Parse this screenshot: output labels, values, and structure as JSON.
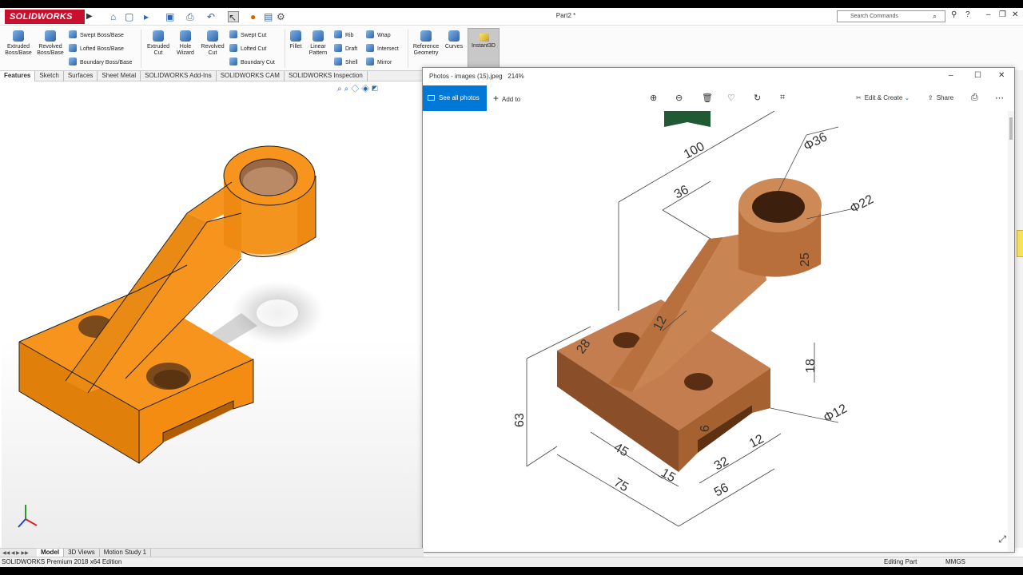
{
  "app": {
    "logo_text": "SOLIDWORKS",
    "document_title": "Part2 *",
    "search_placeholder": "Search Commands"
  },
  "ribbon": {
    "extruded_boss": "Extruded Boss/Base",
    "revolved_boss": "Revolved Boss/Base",
    "swept_boss": "Swept Boss/Base",
    "lofted_boss": "Lofted Boss/Base",
    "boundary_boss": "Boundary Boss/Base",
    "extruded_cut": "Extruded Cut",
    "hole_wizard": "Hole Wizard",
    "revolved_cut": "Revolved Cut",
    "swept_cut": "Swept Cut",
    "lofted_cut": "Lofted Cut",
    "boundary_cut": "Boundary Cut",
    "fillet": "Fillet",
    "linear_pattern": "Linear Pattern",
    "rib": "Rib",
    "draft": "Draft",
    "shell": "Shell",
    "wrap": "Wrap",
    "intersect": "Intersect",
    "mirror": "Mirror",
    "reference_geometry": "Reference Geometry",
    "curves": "Curves",
    "instant3d": "Instant3D"
  },
  "tabs": [
    "Features",
    "Sketch",
    "Surfaces",
    "Sheet Metal",
    "SOLIDWORKS Add-Ins",
    "SOLIDWORKS CAM",
    "SOLIDWORKS Inspection"
  ],
  "model_tabs": [
    "Model",
    "3D Views",
    "Motion Study 1"
  ],
  "status": {
    "edition": "SOLIDWORKS Premium 2018 x64 Edition",
    "mode": "Editing Part",
    "units": "MMGS"
  },
  "photos": {
    "title": "Photos - images (15).jpeg",
    "zoom": "214%",
    "see_all": "See all photos",
    "add_to": "Add to",
    "edit_create": "Edit & Create",
    "share": "Share",
    "dimensions": {
      "d100": "100",
      "d36": "36",
      "phi36": "Φ36",
      "phi22": "Φ22",
      "d25": "25",
      "d12_rib": "12",
      "d28": "28",
      "d18": "18",
      "phi12": "Φ12",
      "d63": "63",
      "d45": "45",
      "d15": "15",
      "d6": "6",
      "d32": "32",
      "d12_slot": "12",
      "d75": "75",
      "d56": "56"
    }
  }
}
